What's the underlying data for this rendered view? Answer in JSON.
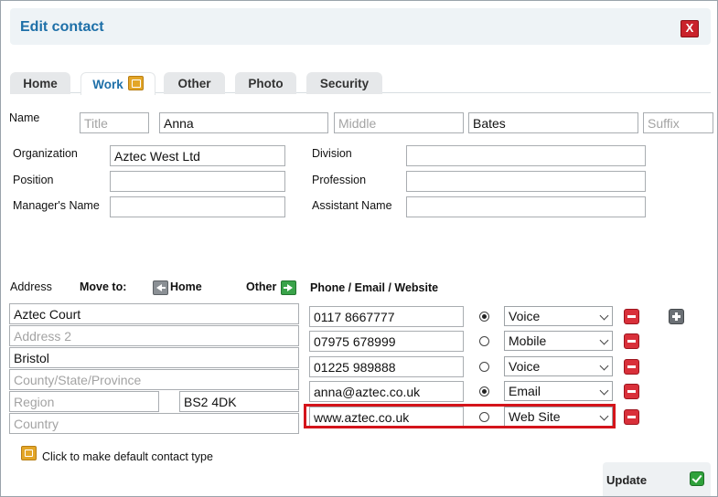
{
  "window": {
    "title": "Edit contact",
    "close_glyph": "X"
  },
  "tabs": [
    {
      "label": "Home"
    },
    {
      "label": "Work",
      "active": true,
      "icon": "default-contact-type-icon"
    },
    {
      "label": "Other"
    },
    {
      "label": "Photo"
    },
    {
      "label": "Security"
    }
  ],
  "name": {
    "label": "Name",
    "title_placeholder": "Title",
    "first": "Anna",
    "middle_placeholder": "Middle",
    "last": "Bates",
    "suffix_placeholder": "Suffix"
  },
  "work": {
    "organization_label": "Organization",
    "organization_value": "Aztec West Ltd",
    "position_label": "Position",
    "managers_name_label": "Manager's Name",
    "division_label": "Division",
    "profession_label": "Profession",
    "assistant_name_label": "Assistant Name"
  },
  "address": {
    "label": "Address",
    "move_to_label": "Move to:",
    "home_label": "Home",
    "other_label": "Other",
    "line1": "Aztec Court",
    "line2_placeholder": "Address 2",
    "city": "Bristol",
    "county_placeholder": "County/State/Province",
    "region_placeholder": "Region",
    "postcode": "BS2 4DK",
    "country_placeholder": "Country"
  },
  "contacts": {
    "header": "Phone / Email / Website",
    "rows": [
      {
        "value": "0117 8667777",
        "default": true,
        "type": "Voice"
      },
      {
        "value": "07975 678999",
        "default": false,
        "type": "Mobile"
      },
      {
        "value": "01225 989888",
        "default": false,
        "type": "Voice"
      },
      {
        "value": "anna@aztec.co.uk",
        "default": true,
        "type": "Email"
      },
      {
        "value": "www.aztec.co.uk",
        "default": false,
        "type": "Web Site"
      }
    ]
  },
  "footer": {
    "default_hint": "Click to make default contact type",
    "update_label": "Update"
  },
  "colors": {
    "accent": "#1d6fa8",
    "highlight": "#d4141b",
    "remove": "#d9303a",
    "confirm": "#2fa13b"
  }
}
